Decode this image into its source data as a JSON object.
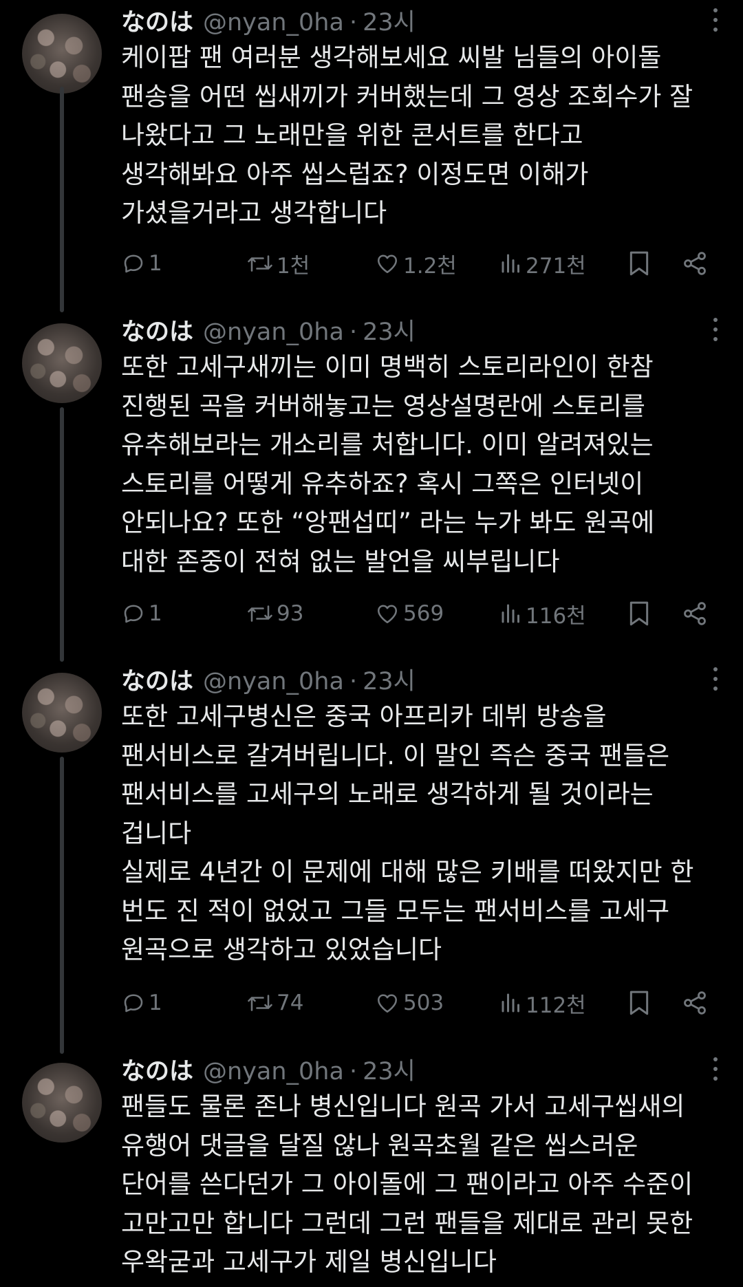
{
  "tweets": [
    {
      "name": "なのは",
      "handle": "@nyan_0ha",
      "separator": "·",
      "time": "23시",
      "text": "케이팝 팬 여러분 생각해보세요 씨발 님들의 아이돌\n팬송을 어떤 씹새끼가 커버했는데 그 영상 조회수가 잘\n나왔다고 그 노래만을 위한 콘서트를 한다고\n생각해봐요 아주 씹스럽죠? 이정도면 이해가\n가셨을거라고 생각합니다",
      "replies": "1",
      "retweets": "1천",
      "likes": "1.2천",
      "views": "271천"
    },
    {
      "name": "なのは",
      "handle": "@nyan_0ha",
      "separator": "·",
      "time": "23시",
      "text": "또한 고세구새끼는 이미 명백히 스토리라인이 한참\n진행된 곡을 커버해놓고는 영상설명란에 스토리를\n유추해보라는 개소리를 처합니다. 이미 알려져있는\n스토리를 어떻게 유추하죠? 혹시 그쪽은 인터넷이\n안되나요? 또한 “앙팬섭띠” 라는 누가 봐도 원곡에\n대한 존중이 전혀 없는 발언을 씨부립니다",
      "replies": "1",
      "retweets": "93",
      "likes": "569",
      "views": "116천"
    },
    {
      "name": "なのは",
      "handle": "@nyan_0ha",
      "separator": "·",
      "time": "23시",
      "text": "또한 고세구병신은 중국 아프리카 데뷔 방송을\n팬서비스로 갈겨버립니다. 이 말인 즉슨 중국 팬들은\n팬서비스를 고세구의 노래로 생각하게 될 것이라는\n겁니다\n실제로 4년간 이 문제에 대해 많은 키배를 떠왔지만 한\n번도 진 적이 없었고 그들 모두는 팬서비스를 고세구\n원곡으로 생각하고 있었습니다",
      "replies": "1",
      "retweets": "74",
      "likes": "503",
      "views": "112천"
    },
    {
      "name": "なのは",
      "handle": "@nyan_0ha",
      "separator": "·",
      "time": "23시",
      "text": "팬들도 물론 존나 병신입니다 원곡 가서 고세구씹새의\n유행어 댓글을 달질 않나 원곡초월 같은 씹스러운\n단어를 쓴다던가 그 아이돌에 그 팬이라고 아주 수준이\n고만고만 합니다 그런데 그런 팬들을 제대로 관리 못한\n우왁굳과 고세구가 제일 병신입니다"
    }
  ],
  "icons": {
    "reply": "reply-icon",
    "retweet": "retweet-icon",
    "like": "heart-icon",
    "views": "views-icon",
    "bookmark": "bookmark-icon",
    "share": "share-icon",
    "more": "more-icon"
  },
  "colors": {
    "background": "#000000",
    "text": "#e7e9ea",
    "muted": "#71767b",
    "thread_line": "#333639"
  }
}
